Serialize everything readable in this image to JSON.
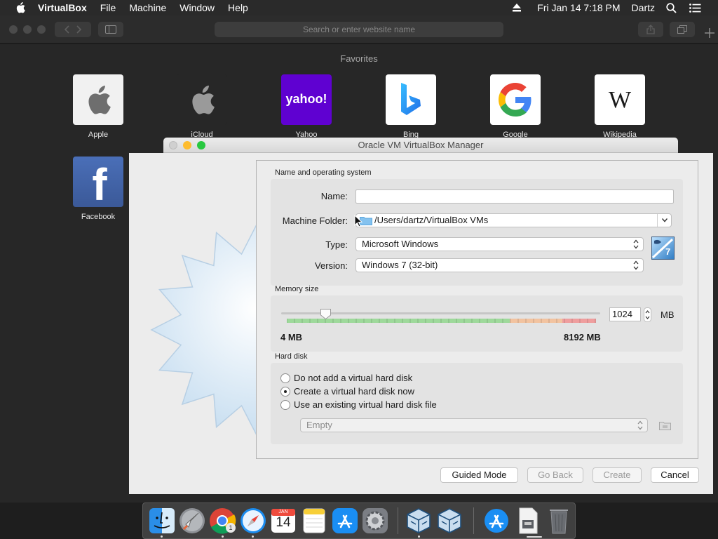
{
  "menubar": {
    "app_name": "VirtualBox",
    "items": [
      "File",
      "Machine",
      "Window",
      "Help"
    ],
    "clock": "Fri Jan 14  7:18 PM",
    "user": "Dartz"
  },
  "safari": {
    "search_placeholder": "Search or enter website name",
    "favorites_title": "Favorites",
    "favorites": [
      {
        "label": "Apple"
      },
      {
        "label": "iCloud"
      },
      {
        "label": "Yahoo",
        "logo_text": "yahoo!"
      },
      {
        "label": "Bing"
      },
      {
        "label": "Google"
      },
      {
        "label": "Wikipedia",
        "logo_text": "W"
      },
      {
        "label": "Facebook",
        "logo_text": "f"
      }
    ]
  },
  "vbox": {
    "title": "Oracle VM VirtualBox Manager",
    "sections": {
      "name_os": "Name and operating system",
      "memory": "Memory size",
      "hard_disk": "Hard disk"
    },
    "fields": {
      "name_label": "Name:",
      "name_value": "",
      "folder_label": "Machine Folder:",
      "folder_value": "/Users/dartz/VirtualBox VMs",
      "type_label": "Type:",
      "type_value": "Microsoft Windows",
      "version_label": "Version:",
      "version_value": "Windows 7 (32-bit)",
      "os_badge": "7"
    },
    "memory": {
      "value": "1024",
      "unit": "MB",
      "min_label": "4 MB",
      "max_label": "8192 MB",
      "min_mb": 4,
      "max_mb": 8192,
      "current_mb": 1024
    },
    "hard_disk": {
      "options": [
        "Do not add a virtual hard disk",
        "Create a virtual hard disk now",
        "Use an existing virtual hard disk file"
      ],
      "selected_index": 1,
      "file_value": "Empty"
    },
    "buttons": {
      "guided": "Guided Mode",
      "back": "Go Back",
      "create": "Create",
      "cancel": "Cancel"
    }
  },
  "dock": {
    "calendar_month": "JAN",
    "calendar_day": "14",
    "badge": "1"
  },
  "colors": {
    "traffic_close": "#ff5f57",
    "traffic_min": "#febc2e",
    "traffic_max": "#28c840",
    "mem_green": "#9ed99b",
    "mem_orange": "#f2c3a0",
    "mem_red": "#ef9e9e"
  }
}
